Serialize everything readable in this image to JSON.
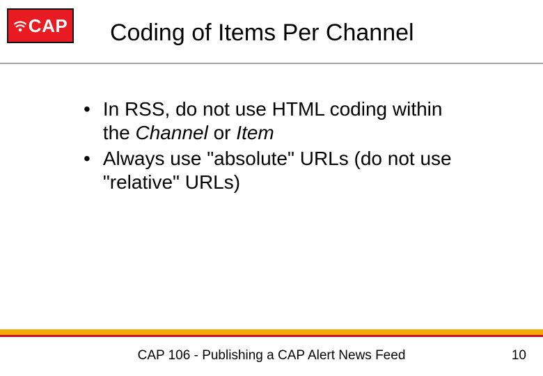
{
  "logo": {
    "text": "CAP"
  },
  "title": "Coding of Items Per Channel",
  "bullets": [
    {
      "pre": "In RSS, do not use HTML coding within the ",
      "italic1": "Channel",
      "mid": " or ",
      "italic2": "Item",
      "post": ""
    },
    {
      "pre": "Always use \"absolute\" URLs (do not use \"relative\" URLs)",
      "italic1": "",
      "mid": "",
      "italic2": "",
      "post": ""
    }
  ],
  "footer": "CAP 106 - Publishing a CAP Alert News Feed",
  "page_number": "10",
  "colors": {
    "logo_bg": "#e81b23",
    "footer_yellow": "#f2a900",
    "footer_red": "#c8102e"
  }
}
